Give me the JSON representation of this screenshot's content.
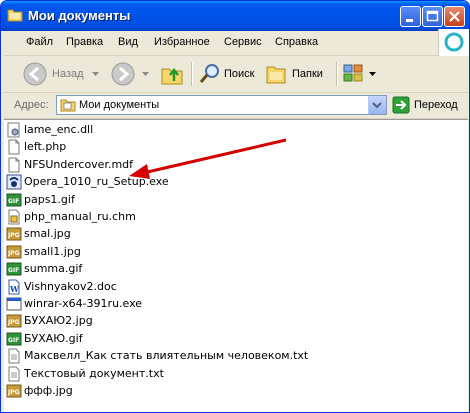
{
  "window": {
    "title": "Мои документы"
  },
  "menu": {
    "items": [
      "Файл",
      "Правка",
      "Вид",
      "Избранное",
      "Сервис",
      "Справка"
    ]
  },
  "toolbar": {
    "back_label": "Назад",
    "search_label": "Поиск",
    "folders_label": "Папки"
  },
  "address": {
    "label": "Адрес:",
    "value": "Мои документы",
    "go_label": "Переход"
  },
  "files": [
    {
      "name": "lame_enc.dll",
      "icon": "dll-icon"
    },
    {
      "name": "left.php",
      "icon": "document-icon"
    },
    {
      "name": "NFSUndercover.mdf",
      "icon": "document-icon"
    },
    {
      "name": "Opera_1010_ru_Setup.exe",
      "icon": "installer-icon"
    },
    {
      "name": "paps1.gif",
      "icon": "gif-icon"
    },
    {
      "name": "php_manual_ru.chm",
      "icon": "chm-icon"
    },
    {
      "name": "smal.jpg",
      "icon": "jpg-icon"
    },
    {
      "name": "small1.jpg",
      "icon": "jpg-icon"
    },
    {
      "name": "summa.gif",
      "icon": "gif-icon"
    },
    {
      "name": "Vishnyakov2.doc",
      "icon": "word-doc-icon"
    },
    {
      "name": "winrar-x64-391ru.exe",
      "icon": "exe-icon"
    },
    {
      "name": "БУХАЮ2.jpg",
      "icon": "jpg-icon"
    },
    {
      "name": "БУХАЮ.gif",
      "icon": "gif-icon"
    },
    {
      "name": "Максвелл_Как стать влиятельным человеком.txt",
      "icon": "text-file-icon"
    },
    {
      "name": "Текстовый документ.txt",
      "icon": "text-file-icon"
    },
    {
      "name": "ффф.jpg",
      "icon": "jpg-icon"
    }
  ],
  "colors": {
    "titlebar": "#0054e3",
    "annotation_arrow": "#d40000"
  }
}
